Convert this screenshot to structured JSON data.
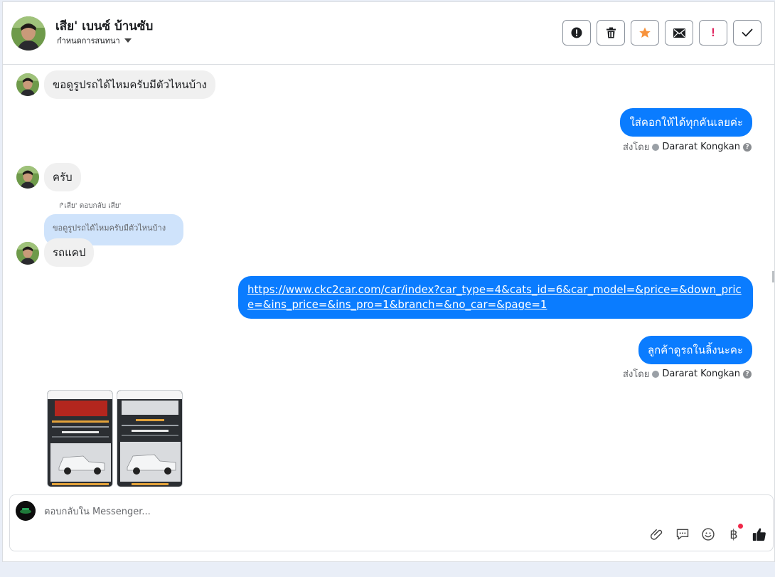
{
  "header": {
    "name": "เสีย' เบนซ์ บ้านซับ",
    "subtitle": "กำหนดการสนทนา"
  },
  "messages": {
    "m1": "ขอดูรูปรถได้ไหมครับมีตัวไหนบ้าง",
    "m2": "ใส่คอกให้ได้ทุกคันเลยค่ะ",
    "m3": "ครับ",
    "reply_note": "เสีย' ตอบกลับ เสีย'",
    "quoted": "ขอดูรูปรถได้ไหมครับมีตัวไหนบ้าง",
    "m4": "รถแคป",
    "link": "https://www.ckc2car.com/car/index?car_type=4&cats_id=6&car_model=&price=&down_price=&ins_price=&ins_pro=1&branch=&no_car=&page=1",
    "m5": "ลูกค้าดูรถในลิ้งนะคะ"
  },
  "sent_by": {
    "prefix": "ส่งโดย",
    "agent": "Dararat Kongkan"
  },
  "composer": {
    "placeholder": "ตอบกลับใน Messenger..."
  },
  "colors": {
    "outgoing_bubble": "#0a7cff",
    "incoming_bubble": "#f0f0f0",
    "quoted_bubble": "#cfe3fb",
    "star": "#f7923b",
    "alert_red": "#e0245e"
  },
  "icons": {
    "toolbar": [
      "alert-circle-icon",
      "trash-icon",
      "star-icon",
      "envelope-icon",
      "exclamation-icon",
      "check-icon"
    ],
    "composer": [
      "paperclip-icon",
      "chat-bubble-icon",
      "smiley-icon",
      "baht-icon",
      "thumbs-up-icon"
    ]
  }
}
